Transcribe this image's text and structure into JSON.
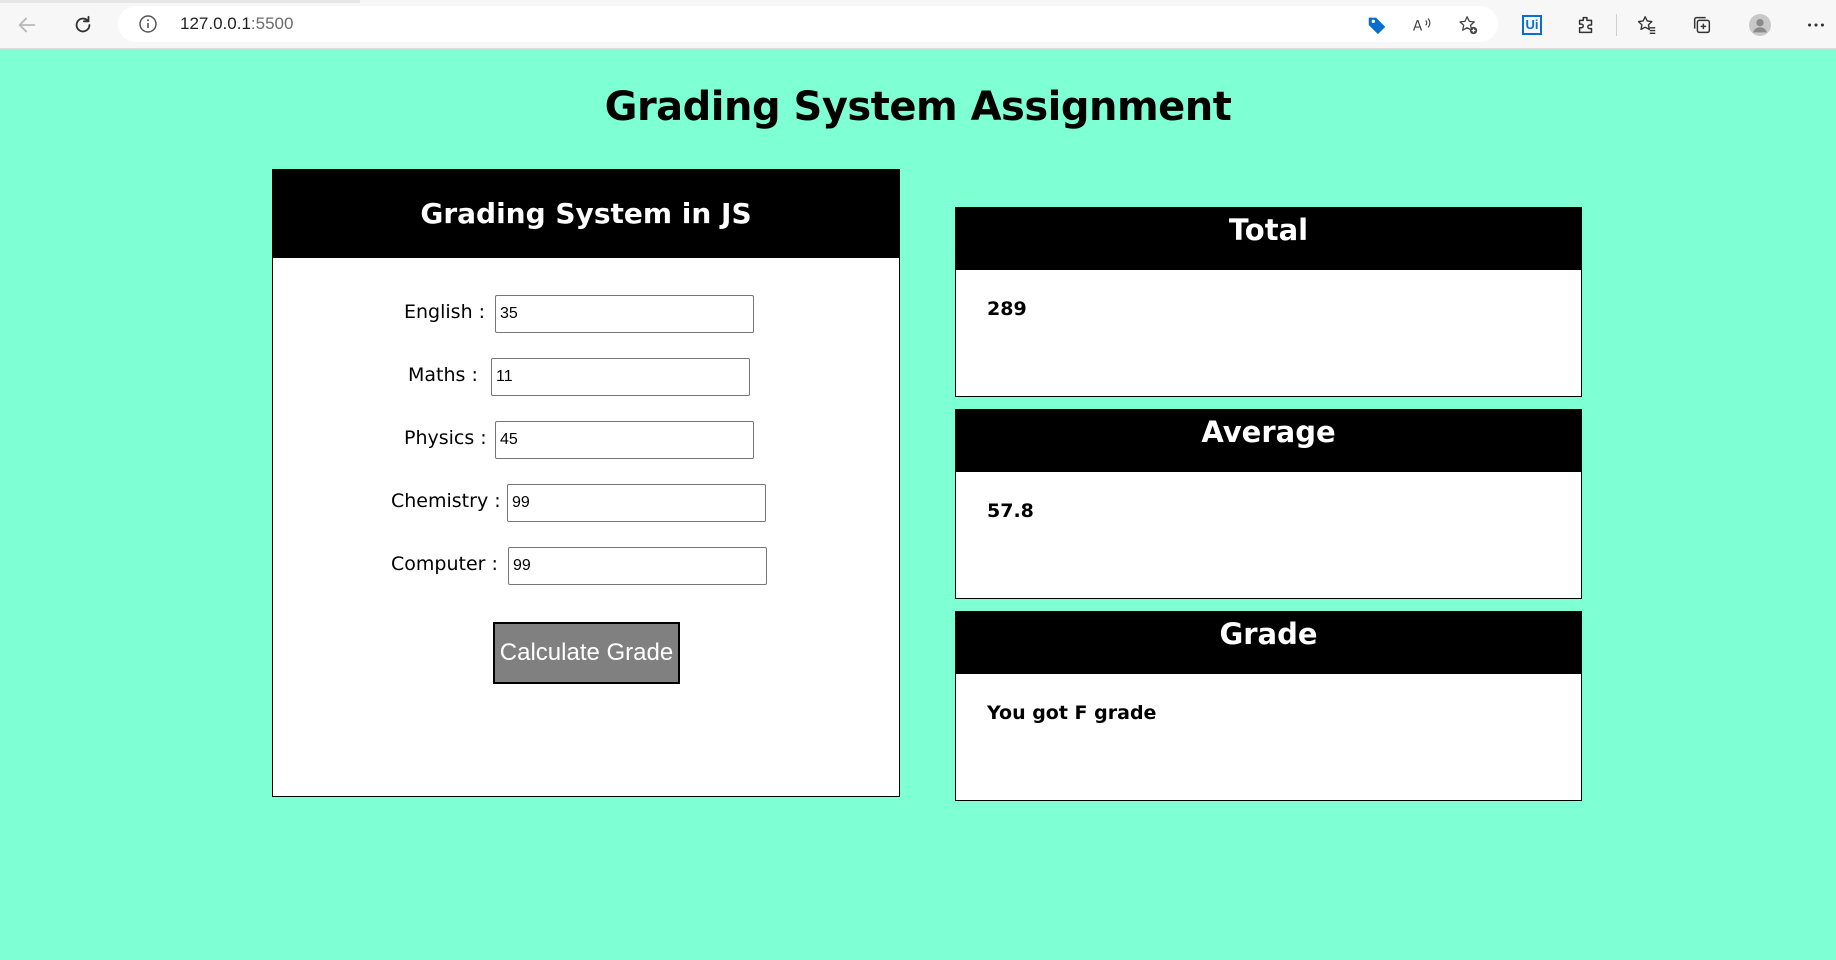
{
  "browser": {
    "url_host": "127.0.0.1",
    "url_port": ":5500",
    "icons": [
      "back-icon",
      "refresh-icon",
      "info-icon",
      "tag-icon",
      "read-aloud-icon",
      "add-favorite-icon",
      "ui-extension-icon",
      "extensions-icon",
      "favorites-icon",
      "collections-icon",
      "profile-icon",
      "more-icon"
    ],
    "ui_ext_label": "Ui"
  },
  "page": {
    "title": "Grading System Assignment"
  },
  "form": {
    "header": "Grading System in JS",
    "fields": [
      {
        "label": "English :",
        "value": "35"
      },
      {
        "label": "Maths :",
        "value": "11"
      },
      {
        "label": "Physics :",
        "value": "45"
      },
      {
        "label": "Chemistry :",
        "value": "99"
      },
      {
        "label": "Computer :",
        "value": "99"
      }
    ],
    "button_label": "Calculate Grade"
  },
  "results": {
    "total": {
      "header": "Total",
      "value": "289"
    },
    "average": {
      "header": "Average",
      "value": "57.8"
    },
    "grade": {
      "header": "Grade",
      "value": "You got F grade"
    }
  },
  "colors": {
    "background": "#7fffd4",
    "header_bg": "#000000",
    "button_bg": "#808080",
    "accent_blue": "#0a6ed1"
  }
}
